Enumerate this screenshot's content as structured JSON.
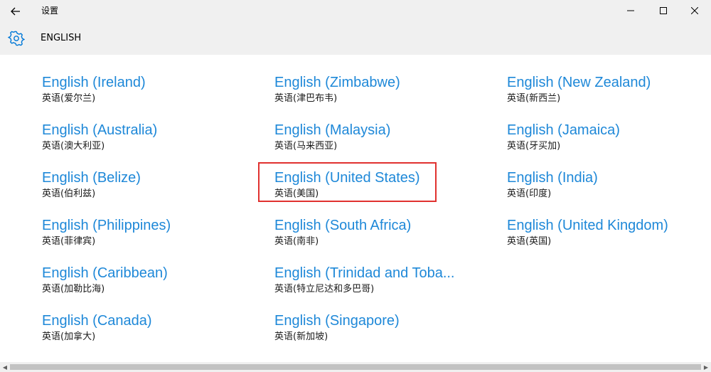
{
  "window": {
    "title": "设置",
    "controls": {
      "minimize": "minimize-icon",
      "maximize": "maximize-icon",
      "close": "close-icon"
    }
  },
  "header": {
    "icon": "gear-icon",
    "title": "ENGLISH"
  },
  "languages": [
    {
      "name": "English (Ireland)",
      "native": "英语(爱尔兰)"
    },
    {
      "name": "English (Australia)",
      "native": "英语(澳大利亚)"
    },
    {
      "name": "English (Belize)",
      "native": "英语(伯利兹)"
    },
    {
      "name": "English (Philippines)",
      "native": "英语(菲律宾)"
    },
    {
      "name": "English (Caribbean)",
      "native": "英语(加勒比海)"
    },
    {
      "name": "English (Canada)",
      "native": "英语(加拿大)"
    },
    {
      "name": "English (Zimbabwe)",
      "native": "英语(津巴布韦)"
    },
    {
      "name": "English (Malaysia)",
      "native": "英语(马来西亚)"
    },
    {
      "name": "English (United States)",
      "native": "英语(美国)"
    },
    {
      "name": "English (South Africa)",
      "native": "英语(南非)"
    },
    {
      "name": "English (Trinidad and Toba...",
      "native": "英语(特立尼达和多巴哥)"
    },
    {
      "name": "English (Singapore)",
      "native": "英语(新加坡)"
    },
    {
      "name": "English (New Zealand)",
      "native": "英语(新西兰)"
    },
    {
      "name": "English (Jamaica)",
      "native": "英语(牙买加)"
    },
    {
      "name": "English (India)",
      "native": "英语(印度)"
    },
    {
      "name": "English (United Kingdom)",
      "native": "英语(英国)"
    }
  ],
  "highlighted": "English (United States)",
  "colors": {
    "link": "#1e88d8",
    "accent": "#0078d7",
    "highlight_border": "#e0312f"
  }
}
